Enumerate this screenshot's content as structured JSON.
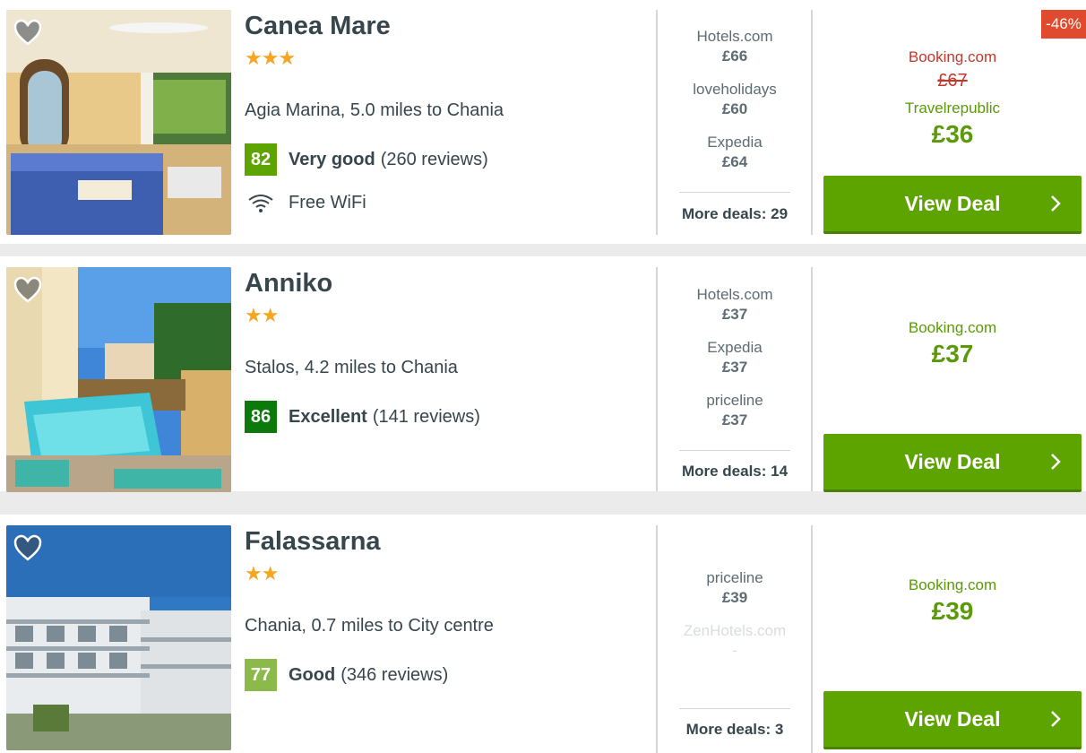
{
  "colors": {
    "accent_green": "#5ea400",
    "price_green": "#5a9a08",
    "discount_red": "#e04b2f",
    "star": "#f5a623",
    "score_very_good": "#5ea400",
    "score_excellent": "#0b7a0b",
    "score_good": "#8bba4a"
  },
  "hotels": [
    {
      "name": "Canea Mare",
      "stars": "★★★",
      "location": "Agia Marina, 5.0 miles to Chania",
      "score": "82",
      "rating_word": "Very good",
      "reviews": "(260 reviews)",
      "amenity": "Free WiFi",
      "amenity_icon": "wifi-icon",
      "deals": [
        {
          "provider": "Hotels.com",
          "price": "£66"
        },
        {
          "provider": "loveholidays",
          "price": "£60"
        },
        {
          "provider": "Expedia",
          "price": "£64"
        }
      ],
      "more_deals": "More deals: 29",
      "discount": "-46%",
      "best_top_provider": "Booking.com",
      "best_old_price": "£67",
      "best_provider": "Travelrepublic",
      "best_price": "£36",
      "cta": "View Deal"
    },
    {
      "name": "Anniko",
      "stars": "★★",
      "location": "Stalos, 4.2 miles to Chania",
      "score": "86",
      "rating_word": "Excellent",
      "reviews": "(141 reviews)",
      "deals": [
        {
          "provider": "Hotels.com",
          "price": "£37"
        },
        {
          "provider": "Expedia",
          "price": "£37"
        },
        {
          "provider": "priceline",
          "price": "£37"
        }
      ],
      "more_deals": "More deals: 14",
      "best_provider": "Booking.com",
      "best_price": "£37",
      "cta": "View Deal"
    },
    {
      "name": "Falassarna",
      "stars": "★★",
      "location": "Chania, 0.7 miles to City centre",
      "score": "77",
      "rating_word": "Good",
      "reviews": "(346 reviews)",
      "deals": [
        {
          "provider": "priceline",
          "price": "£39"
        },
        {
          "provider": "ZenHotels.com",
          "price": "-"
        }
      ],
      "more_deals": "More deals: 3",
      "best_provider": "Booking.com",
      "best_price": "£39",
      "cta": "View Deal"
    }
  ]
}
